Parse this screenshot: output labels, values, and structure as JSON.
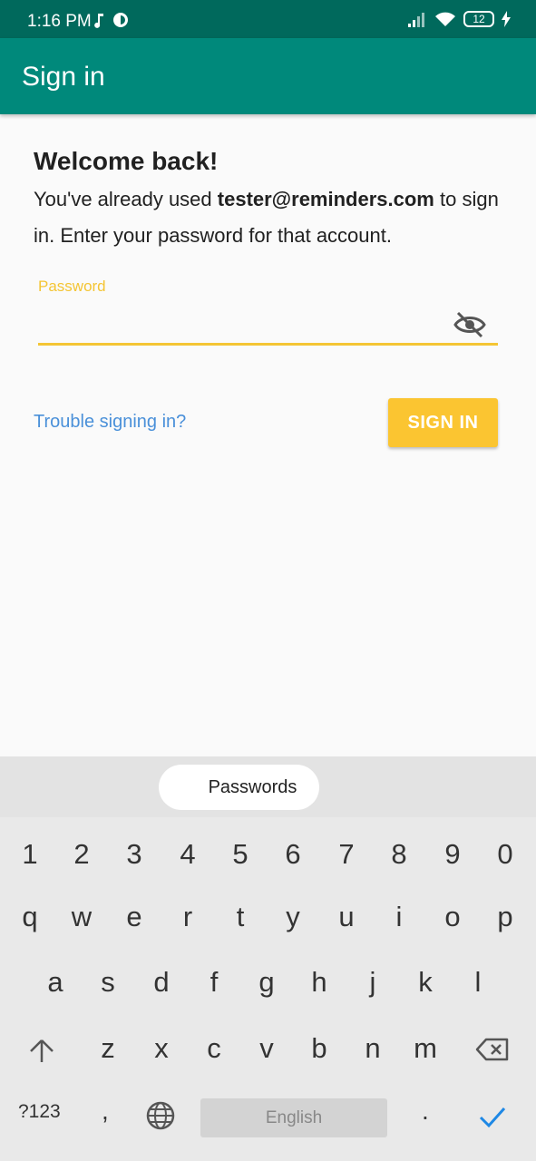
{
  "status_bar": {
    "time": "1:16 PM",
    "battery": "12",
    "icons": [
      "music-note-icon",
      "data-saver-icon",
      "signal-icon",
      "wifi-icon",
      "battery-icon",
      "charging-icon"
    ]
  },
  "app_bar": {
    "title": "Sign in"
  },
  "main": {
    "heading": "Welcome back!",
    "info_prefix": "You've already used ",
    "email": "tester@reminders.com",
    "info_suffix": " to sign in. Enter your password for that account.",
    "password_label": "Password",
    "password_value": "",
    "trouble_link": "Trouble signing in?",
    "signin_button": "SIGN IN"
  },
  "keyboard": {
    "suggestion": "Passwords",
    "row_numbers": [
      "1",
      "2",
      "3",
      "4",
      "5",
      "6",
      "7",
      "8",
      "9",
      "0"
    ],
    "row_top": [
      "q",
      "w",
      "e",
      "r",
      "t",
      "y",
      "u",
      "i",
      "o",
      "p"
    ],
    "row_middle": [
      "a",
      "s",
      "d",
      "f",
      "g",
      "h",
      "j",
      "k",
      "l"
    ],
    "row_bottom": [
      "z",
      "x",
      "c",
      "v",
      "b",
      "n",
      "m"
    ],
    "symbols_key": "?123",
    "comma_key": ",",
    "space_label": "English",
    "period_key": ".",
    "accent_color": "#1e88e5"
  },
  "colors": {
    "status_bar": "#00695c",
    "app_bar": "#00897b",
    "accent_yellow": "#fbc531",
    "link_blue": "#4a90d9"
  }
}
